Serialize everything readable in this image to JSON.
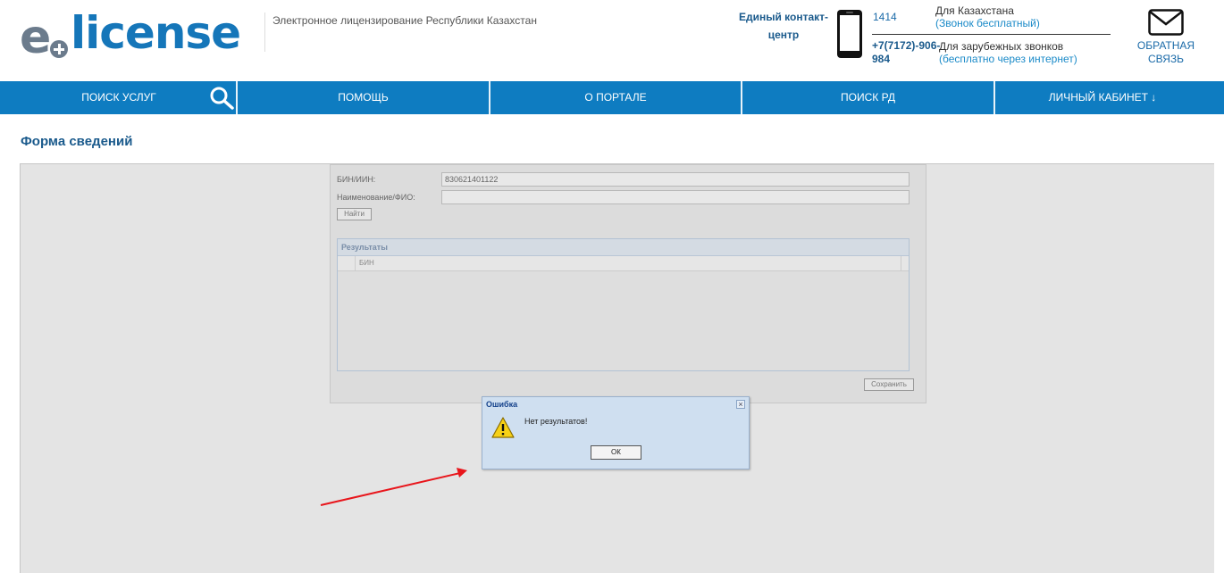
{
  "header": {
    "logo_e": "e",
    "logo_text": "license",
    "tagline": "Электронное лицензирование Республики Казахстан",
    "contact_label": "Единый контакт-центр",
    "local_number": "1414",
    "local_label": "Для Казахстана",
    "local_free": "(Звонок бесплатный)",
    "intl_number": "+7(7172)-906-984",
    "intl_label": "Для зарубежных звонков",
    "intl_free": "(бесплатно через интернет)",
    "feedback_label": "ОБРАТНАЯ СВЯЗЬ"
  },
  "nav": {
    "items": [
      {
        "label": "ПОИСК УСЛУГ"
      },
      {
        "label": "ПОМОЩЬ"
      },
      {
        "label": "О ПОРТАЛЕ"
      },
      {
        "label": "ПОИСК РД"
      },
      {
        "label": "ЛИЧНЫЙ КАБИНЕТ ↓"
      }
    ],
    "color": "#0e7cc1"
  },
  "page": {
    "title": "Форма сведений"
  },
  "form": {
    "bin_label": "БИН/ИИН:",
    "bin_value": "830621401122",
    "name_label": "Наименование/ФИО:",
    "name_value": "",
    "find_button": "Найти",
    "results_title": "Результаты",
    "results_col": "БИН",
    "save_button": "Сохранить"
  },
  "dialog": {
    "title": "Ошибка",
    "message": "Нет результатов!",
    "ok_button": "ОК",
    "close_icon": "close-icon",
    "warning_icon": "warning-icon"
  },
  "colors": {
    "brand_blue": "#1576b9",
    "annotation_arrow": "#e8151b"
  }
}
